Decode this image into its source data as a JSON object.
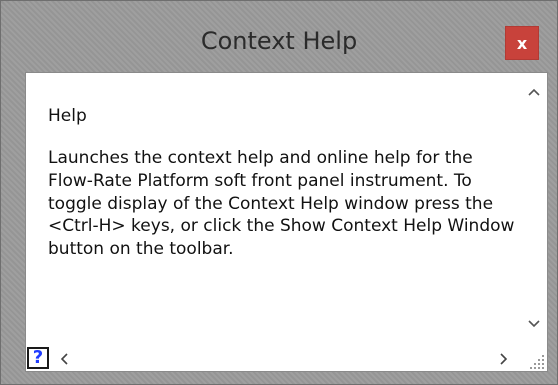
{
  "window": {
    "title": "Context Help",
    "close_label": "x"
  },
  "help": {
    "heading": "Help",
    "body": "Launches the context help and online help for the Flow-Rate Platform soft front panel instrument. To toggle display of the Context Help window press the <Ctrl-H> keys, or click the Show Context Help Window button on the toolbar."
  },
  "toolbar": {
    "help_button_label": "?"
  },
  "scroll": {
    "up": "^",
    "down": "v",
    "left": "<",
    "right": ">"
  },
  "icons": {
    "close": "close-icon",
    "help": "question-mark-icon",
    "up": "chevron-up-icon",
    "down": "chevron-down-icon",
    "left": "chevron-left-icon",
    "right": "chevron-right-icon",
    "grip": "resize-grip-icon"
  },
  "colors": {
    "close_button": "#c8423b",
    "help_glyph": "#1f3cff",
    "title_bg": "#9a9a9a"
  }
}
